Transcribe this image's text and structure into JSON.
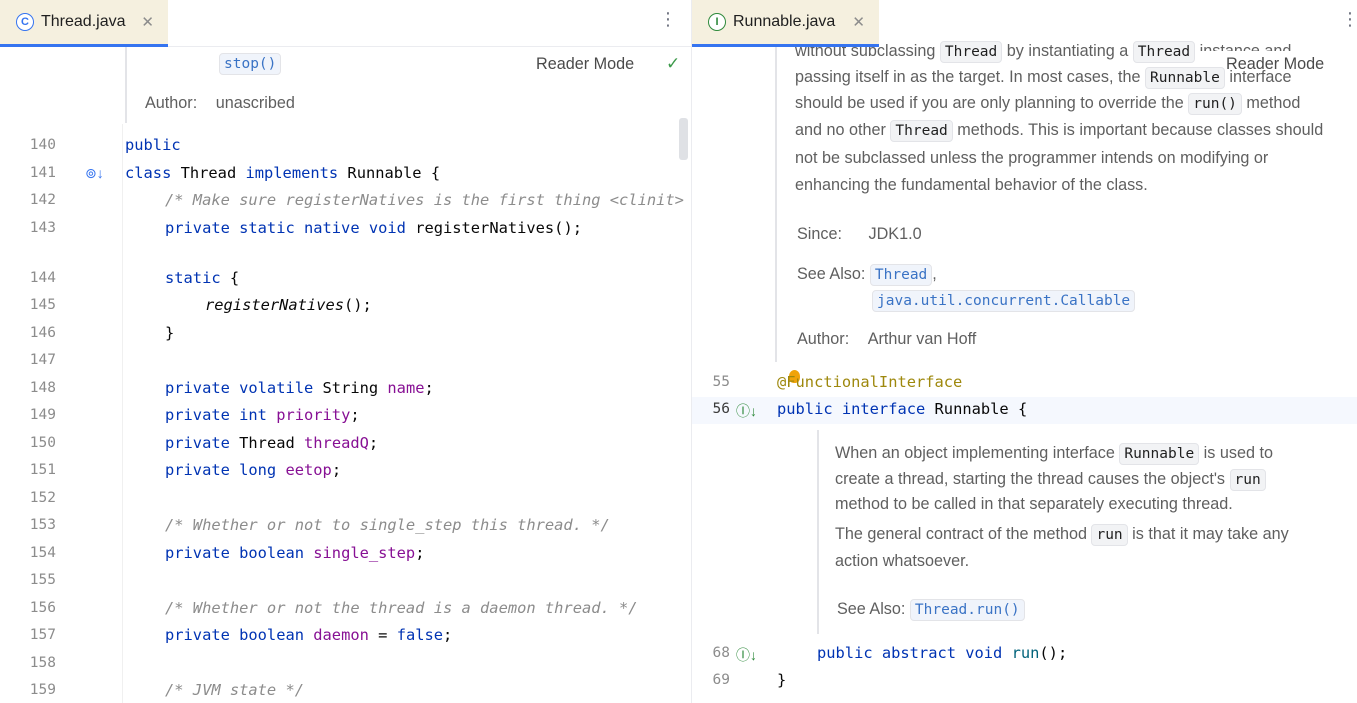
{
  "left": {
    "tab": {
      "label": "Thread.java",
      "icon": "class-icon",
      "icon_letter": "C"
    },
    "header_doc": {
      "see_also_item": "stop()",
      "author_label": "Author:",
      "author_value": "unascribed"
    },
    "reader_mode": "Reader Mode",
    "lines": {
      "n140": "140",
      "n141": "141",
      "n142": "142",
      "n143": "143",
      "n144": "144",
      "n145": "145",
      "n146": "146",
      "n147": "147",
      "n148": "148",
      "n149": "149",
      "n150": "150",
      "n151": "151",
      "n152": "152",
      "n153": "153",
      "n154": "154",
      "n155": "155",
      "n156": "156",
      "n157": "157",
      "n158": "158",
      "n159": "159"
    },
    "code": {
      "l140_kw": "public",
      "l141_kw1": "class",
      "l141_name": " Thread ",
      "l141_kw2": "implements",
      "l141_rest": " Runnable {",
      "l142_cmt": "/* Make sure registerNatives is the first thing <clinit> does. */",
      "l143_kw": "private static native void",
      "l143_rest": " registerNatives();",
      "l144_kw": "static",
      "l144_rest": " {",
      "l145_call": "registerNatives",
      "l145_rest": "();",
      "l146": "}",
      "l148_kw": "private volatile",
      "l148_type": " String ",
      "l148_fld": "name",
      "l148_end": ";",
      "l149_kw": "private int",
      "l149_fld": " priority",
      "l149_end": ";",
      "l150_kw": "private",
      "l150_type": " Thread ",
      "l150_fld": "threadQ",
      "l150_end": ";",
      "l151_kw": "private long",
      "l151_fld": " eetop",
      "l151_end": ";",
      "l153_cmt": "/* Whether or not to single_step this thread. */",
      "l154_kw": "private boolean",
      "l154_fld": " single_step",
      "l154_end": ";",
      "l156_cmt": "/* Whether or not the thread is a daemon thread. */",
      "l157_kw": "private boolean",
      "l157_fld": " daemon",
      "l157_eq": " = ",
      "l157_val": "false",
      "l157_end": ";",
      "l159_cmt": "/* JVM state */"
    }
  },
  "right": {
    "tab": {
      "label": "Runnable.java",
      "icon": "interface-icon",
      "icon_letter": "I"
    },
    "reader_mode": "Reader Mode",
    "top_doc": {
      "line0_a": "without subclassing ",
      "line0_chip1": "Thread",
      "line0_b": " by instantiating a ",
      "line0_chip2": "Thread",
      "line0_c": " instance and",
      "line1_a": "passing itself in as the target. In most cases, the ",
      "line1_chip": "Runnable",
      "line1_b": " interface",
      "line2_a": "should be used if you are only planning to override the ",
      "line2_chip": "run()",
      "line2_b": " method",
      "line3_a": "and no other ",
      "line3_chip": "Thread",
      "line3_b": " methods. This is important because classes should",
      "line4": "not be subclassed unless the programmer intends on modifying or",
      "line5": "enhancing the fundamental behavior of the class.",
      "since_label": "Since:",
      "since_value": "JDK1.0",
      "see_also_label": "See Also:",
      "see_also_1": "Thread",
      "see_also_sep": ",",
      "see_also_2": "java.util.concurrent.Callable",
      "author_label": "Author:",
      "author_value": "Arthur van Hoff"
    },
    "lines": {
      "n55": "55",
      "n56": "56",
      "n68": "68",
      "n69": "69"
    },
    "code": {
      "l55_ann": "@FunctionalInterface",
      "l56_kw": "public interface",
      "l56_name": " Runnable",
      "l56_rest": " {",
      "l68_kw": "public abstract void",
      "l68_mth": " run",
      "l68_rest": "();",
      "l69": "}"
    },
    "run_doc": {
      "p1_a": "When an object implementing interface ",
      "p1_chip1": "Runnable",
      "p1_b": " is used to",
      "p1_c": "create a thread, starting the thread causes the object's ",
      "p1_chip2": "run",
      "p1_d": "method to be called in that separately executing thread.",
      "p2_a": "The general contract of the method ",
      "p2_chip": "run",
      "p2_b": " is that it may take any",
      "p2_c": "action whatsoever.",
      "see_also_label": "See Also:",
      "see_also_1": "Thread.run()"
    }
  },
  "colors": {
    "keyword": "#0033b3",
    "field": "#871094",
    "comment": "#8c8c8c",
    "annotation": "#9e880d",
    "active_tab_underline": "#3574f0",
    "active_tab_bg": "#f5f0df"
  }
}
